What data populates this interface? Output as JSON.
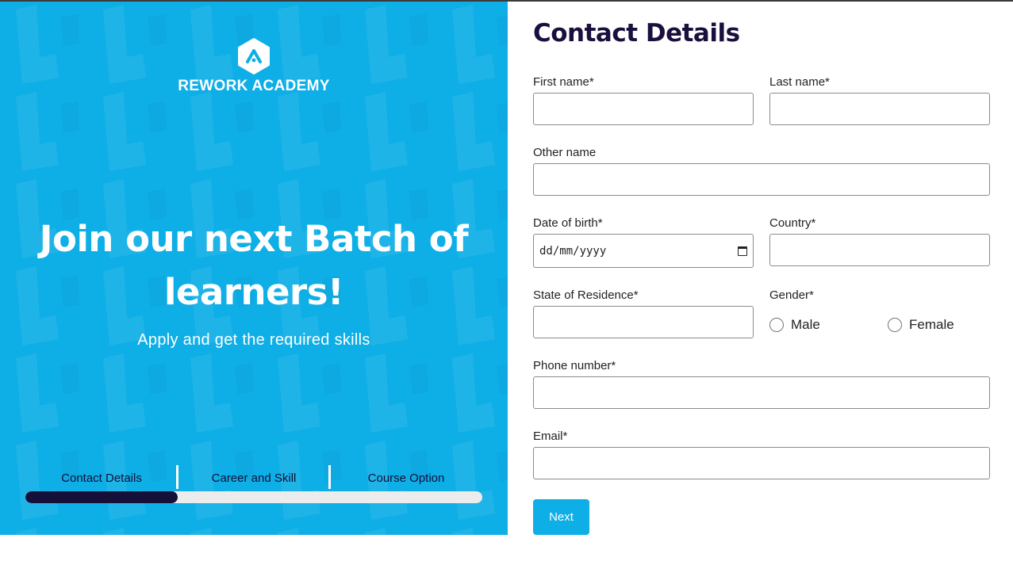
{
  "brand": {
    "name": "REWORK ACADEMY",
    "icon": "rework-academy-logo",
    "primary_color": "#0eaee6",
    "dark_color": "#14103a"
  },
  "hero": {
    "headline": "Join our next Batch of learners!",
    "subheadline": "Apply and get the required skills"
  },
  "steps": {
    "items": [
      {
        "label": "Contact Details"
      },
      {
        "label": "Career and Skill"
      },
      {
        "label": "Course Option"
      }
    ],
    "current": 1,
    "progress_fraction": 0.333
  },
  "form": {
    "title": "Contact Details",
    "first_name": {
      "label": "First name*",
      "value": ""
    },
    "last_name": {
      "label": "Last name*",
      "value": ""
    },
    "other_name": {
      "label": "Other name",
      "value": ""
    },
    "date_of_birth": {
      "label": "Date of birth*",
      "placeholder": "dd/mm/yyyy",
      "icon": "calendar-icon"
    },
    "country": {
      "label": "Country*",
      "value": ""
    },
    "state": {
      "label": "State of Residence*",
      "value": ""
    },
    "gender": {
      "label": "Gender*",
      "options": [
        "Male",
        "Female"
      ],
      "selected": null
    },
    "phone": {
      "label": "Phone number*",
      "value": ""
    },
    "email": {
      "label": "Email*",
      "value": ""
    },
    "next_label": "Next"
  }
}
